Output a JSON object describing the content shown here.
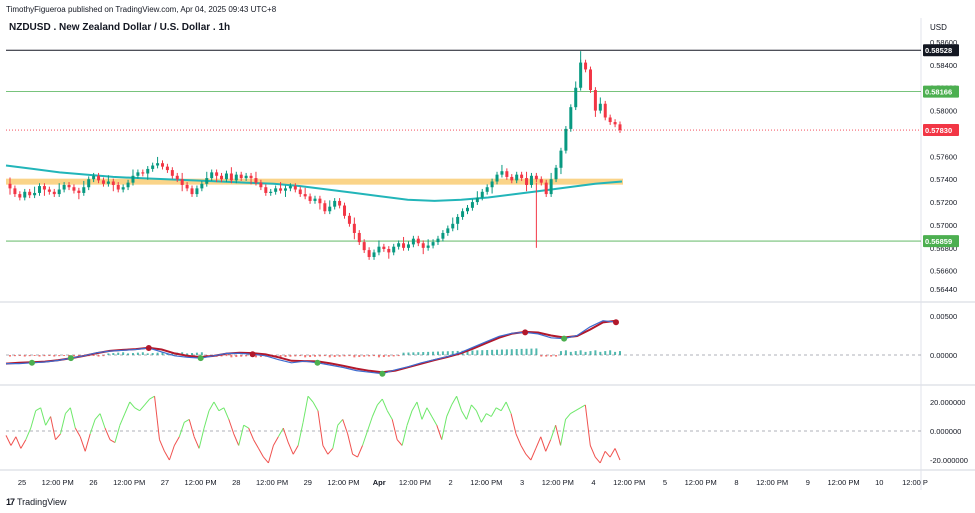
{
  "header": {
    "published": "TimothyFigueroa published on TradingView.com, Apr 04, 2025 09:43 UTC+8",
    "title": "NZDUSD . New Zealand Dollar / U.S. Dollar . 1h",
    "currency": "USD",
    "logo": "TradingView"
  },
  "colors": {
    "up": "#089981",
    "down": "#f23645",
    "ma": "#22b5b9",
    "zone": "#f9cd74",
    "green_line": "#4caf50",
    "black_line": "#131722",
    "red_line": "#f23645",
    "macd": "#3d6bcf",
    "signal_up": "#4caf50",
    "signal_down": "#b2182b",
    "osc_up": "#6ee86a",
    "osc_down": "#f0524f",
    "hist_up": "#26a69a",
    "hist_down": "#ef5350"
  },
  "chart_data": [
    {
      "type": "candlestick",
      "panel": "price",
      "y_ticks": [
        "0.58600",
        "0.58400",
        "0.58200",
        "0.58000",
        "0.57600",
        "0.57400",
        "0.57200",
        "0.57000",
        "0.56800",
        "0.56600",
        "0.56440"
      ],
      "ylim": [
        0.5638,
        0.5868
      ],
      "levels": [
        {
          "name": "black",
          "value": 0.58528,
          "label": "0.58528",
          "color": "#131722"
        },
        {
          "name": "upper-green",
          "value": 0.58166,
          "label": "0.58166",
          "color": "#4caf50"
        },
        {
          "name": "last-price",
          "value": 0.5783,
          "label": "0.57830",
          "color": "#f23645",
          "dotted": true
        },
        {
          "name": "lower-green",
          "value": 0.56859,
          "label": "0.56859",
          "color": "#4caf50"
        }
      ],
      "zone": {
        "low": 0.57355,
        "high": 0.57405,
        "x_start": 0,
        "x_end": 124
      },
      "candles_close": [
        0.5732,
        0.5727,
        0.5724,
        0.5729,
        0.5726,
        0.5728,
        0.5734,
        0.5731,
        0.5729,
        0.5727,
        0.5731,
        0.5735,
        0.5733,
        0.573,
        0.5728,
        0.5733,
        0.574,
        0.5743,
        0.5739,
        0.5736,
        0.5738,
        0.5735,
        0.5731,
        0.5733,
        0.5737,
        0.5743,
        0.5746,
        0.5745,
        0.5749,
        0.5752,
        0.5754,
        0.5751,
        0.5748,
        0.5743,
        0.574,
        0.5735,
        0.5732,
        0.5727,
        0.5732,
        0.5736,
        0.5741,
        0.5746,
        0.5743,
        0.574,
        0.5745,
        0.5739,
        0.5744,
        0.5741,
        0.5743,
        0.5741,
        0.5737,
        0.5733,
        0.5728,
        0.5729,
        0.5732,
        0.573,
        0.5732,
        0.5734,
        0.5731,
        0.5727,
        0.5725,
        0.5721,
        0.5723,
        0.5719,
        0.5712,
        0.5716,
        0.5721,
        0.5717,
        0.5708,
        0.5701,
        0.5693,
        0.5685,
        0.5678,
        0.5672,
        0.5676,
        0.5681,
        0.5679,
        0.5676,
        0.5681,
        0.5684,
        0.568,
        0.5683,
        0.5688,
        0.5684,
        0.568,
        0.5682,
        0.5685,
        0.5688,
        0.5693,
        0.5697,
        0.5701,
        0.5707,
        0.5712,
        0.5715,
        0.572,
        0.5724,
        0.5729,
        0.5733,
        0.5738,
        0.5744,
        0.5747,
        0.5742,
        0.5739,
        0.5744,
        0.5741,
        0.5735,
        0.5743,
        0.574,
        0.5737,
        0.5727,
        0.574,
        0.575,
        0.5765,
        0.5784,
        0.5803,
        0.582,
        0.5842,
        0.5836,
        0.5818,
        0.58,
        0.5806,
        0.5794,
        0.579,
        0.5788,
        0.5783
      ],
      "x_ticks": [
        "25",
        "12:00 PM",
        "26",
        "12:00 PM",
        "27",
        "12:00 PM",
        "28",
        "12:00 PM",
        "29",
        "12:00 PM",
        "Apr",
        "12:00 PM",
        "2",
        "12:00 PM",
        "3",
        "12:00 PM",
        "4",
        "12:00 PM",
        "5",
        "12:00 PM",
        "8",
        "12:00 PM",
        "9",
        "12:00 PM",
        "10",
        "12:00 P"
      ]
    },
    {
      "type": "line",
      "panel": "macd",
      "y_ticks": [
        "0.00500",
        "0.00000"
      ],
      "ylim": [
        -0.0015,
        0.0065
      ],
      "series": [
        {
          "values": []
        },
        {
          "values": []
        }
      ]
    },
    {
      "type": "line",
      "panel": "oscillator",
      "y_ticks": [
        "20.000000",
        "0.000000",
        "-20.000000"
      ],
      "ylim": [
        -28,
        30
      ],
      "series": [
        {
          "values": [
            -3,
            -10,
            -4,
            -12,
            -6,
            2,
            14,
            16,
            4,
            10,
            -6,
            -2,
            12,
            16,
            2,
            -4,
            -14,
            -2,
            8,
            12,
            2,
            -6,
            -8,
            4,
            12,
            20,
            16,
            14,
            18,
            22,
            24,
            -6,
            -14,
            -20,
            -10,
            -4,
            6,
            8,
            -4,
            -12,
            2,
            14,
            20,
            14,
            16,
            8,
            -2,
            -10,
            4,
            2,
            -6,
            -12,
            -18,
            -22,
            -10,
            -4,
            2,
            -8,
            -16,
            -10,
            6,
            24,
            20,
            14,
            -10,
            -16,
            -12,
            4,
            8,
            -2,
            -16,
            -18,
            -10,
            0,
            10,
            18,
            22,
            14,
            8,
            -6,
            -10,
            4,
            14,
            20,
            8,
            16,
            10,
            4,
            -6,
            10,
            18,
            24,
            14,
            8,
            18,
            14,
            6,
            12,
            10,
            16,
            14,
            20,
            12,
            -2,
            -10,
            -16,
            -20,
            -12,
            -4,
            -14,
            -6,
            4,
            -10,
            8,
            12,
            14,
            16,
            18,
            -10,
            -18,
            -22,
            -14,
            -18,
            -12,
            -20
          ]
        }
      ]
    }
  ]
}
